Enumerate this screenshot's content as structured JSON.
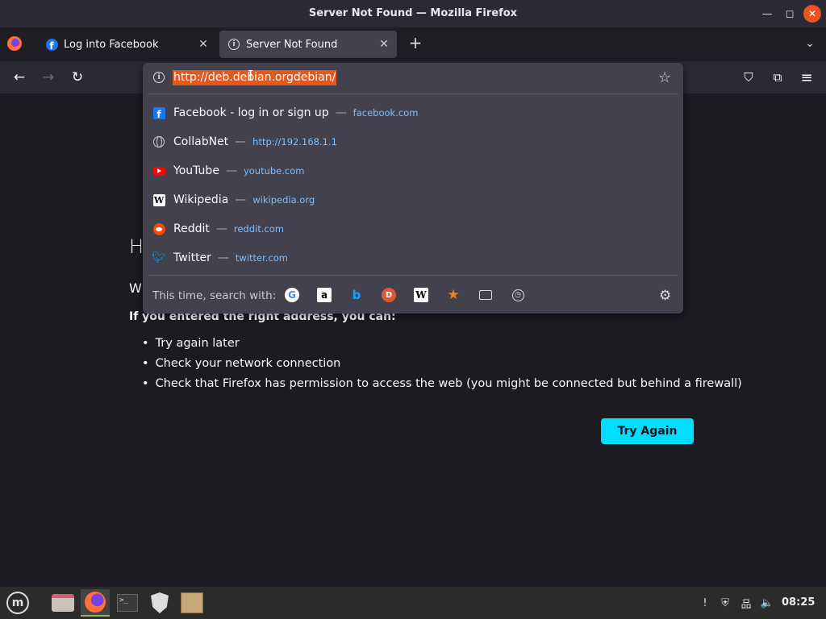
{
  "window": {
    "title": "Server Not Found — Mozilla Firefox",
    "minimize_glyph": "—",
    "maximize_glyph": "◻",
    "close_glyph": "✕"
  },
  "tabs": [
    {
      "label": "Log into Facebook",
      "icon": "facebook-icon",
      "close_glyph": "✕"
    },
    {
      "label": "Server Not Found",
      "icon": "info-icon",
      "close_glyph": "✕",
      "active": true
    }
  ],
  "tabbar": {
    "new_tab_glyph": "+",
    "list_all_glyph": "⌄"
  },
  "nav": {
    "back_glyph": "←",
    "forward_glyph": "→",
    "reload_glyph": "↻",
    "pocket_glyph": "⛉",
    "extensions_glyph": "⧉",
    "menu_glyph": "≡"
  },
  "urlbar": {
    "value": "http://deb.debian.orgdebian/",
    "info_glyph": "i",
    "bookmark_glyph": "☆"
  },
  "suggestions": [
    {
      "title": "Facebook - log in or sign up",
      "url": "facebook.com",
      "icon": "facebook-icon"
    },
    {
      "title": "CollabNet",
      "url": "http://192.168.1.1",
      "icon": "globe-icon"
    },
    {
      "title": "YouTube",
      "url": "youtube.com",
      "icon": "youtube-icon"
    },
    {
      "title": "Wikipedia",
      "url": "wikipedia.org",
      "icon": "wikipedia-icon"
    },
    {
      "title": "Reddit",
      "url": "reddit.com",
      "icon": "reddit-icon"
    },
    {
      "title": "Twitter",
      "url": "twitter.com",
      "icon": "twitter-icon"
    }
  ],
  "suggestion_separator": "—",
  "search_with": {
    "label": "This time, search with:",
    "engines": [
      {
        "name": "google-icon",
        "glyph": "G"
      },
      {
        "name": "amazon-icon",
        "glyph": "a"
      },
      {
        "name": "bing-icon",
        "glyph": "b"
      },
      {
        "name": "duckduckgo-icon",
        "glyph": "D"
      },
      {
        "name": "wikipedia-icon",
        "glyph": "W"
      },
      {
        "name": "bookmarks-icon",
        "glyph": "★"
      },
      {
        "name": "tabs-icon",
        "glyph": ""
      },
      {
        "name": "history-icon",
        "glyph": "◷"
      }
    ],
    "settings_glyph": "⚙"
  },
  "error_page": {
    "title_visible": "H",
    "subtitle_visible": "W",
    "lead": "If you entered the right address, you can:",
    "items": [
      "Try again later",
      "Check your network connection",
      "Check that Firefox has permission to access the web (you might be connected but behind a firewall)"
    ],
    "try_again_label": "Try Again"
  },
  "taskbar": {
    "menu_glyph": "m",
    "terminal_glyph": ">_",
    "tray_icons": [
      "update-icon",
      "shield-tray-icon",
      "network-icon",
      "volume-icon"
    ],
    "update_glyph": "!",
    "shield_glyph": "⛨",
    "network_glyph": "品",
    "volume_glyph": "🔈",
    "clock": "08:25"
  }
}
